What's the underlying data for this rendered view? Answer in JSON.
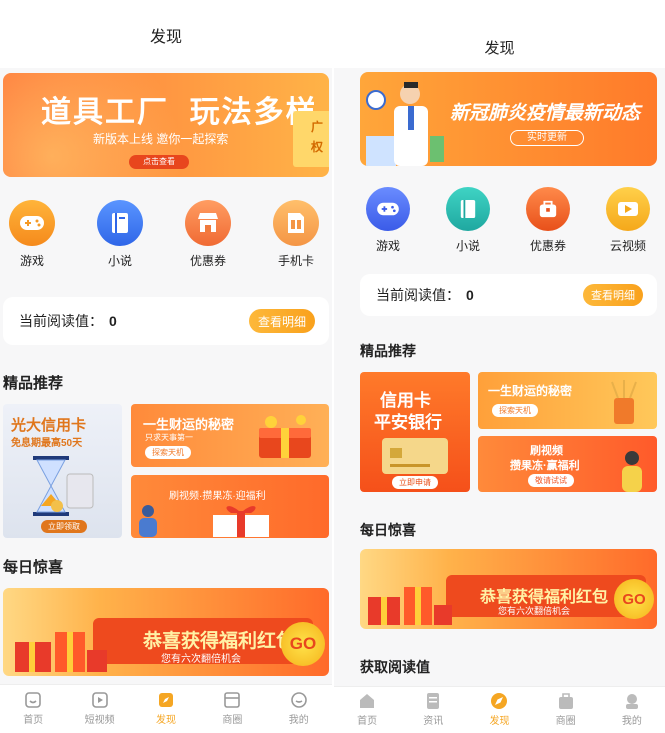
{
  "left": {
    "title": "发现",
    "banner": {
      "headline": "道具工厂  玩法多样",
      "sub": "新版本上线 邀你一起探索",
      "cta": "点击查看",
      "side": "广\n权"
    },
    "icons": [
      {
        "label": "游戏",
        "icon": "gamepad-icon",
        "color": "#f5a623"
      },
      {
        "label": "小说",
        "icon": "book-icon",
        "color": "#3b7ff5"
      },
      {
        "label": "优惠券",
        "icon": "shop-icon",
        "color": "#f07c3a"
      },
      {
        "label": "手机卡",
        "icon": "sim-card-icon",
        "color": "#f3a34a"
      }
    ],
    "reading": {
      "label": "当前阅读值：",
      "value": "0",
      "detail": "查看明细"
    },
    "featured_title": "精品推荐",
    "tiles": {
      "card": {
        "title": "光大信用卡",
        "sub": "免息期最高50天",
        "btn": "立即领取"
      },
      "wealth": {
        "title": "一生财运的秘密",
        "sub": "只求天事第一",
        "btn": "探索天机"
      },
      "video": {
        "title": "刷视频·攒果冻·迎福利"
      }
    },
    "daily_title": "每日惊喜",
    "surprise": {
      "title": "恭喜获得福利红包",
      "sub": "您有六次翻倍机会",
      "go": "GO"
    },
    "tabs": [
      {
        "label": "首页",
        "icon": "home-icon"
      },
      {
        "label": "短视频",
        "icon": "video-icon"
      },
      {
        "label": "发现",
        "icon": "discover-icon",
        "active": true
      },
      {
        "label": "商圈",
        "icon": "store-icon"
      },
      {
        "label": "我的",
        "icon": "profile-icon"
      }
    ]
  },
  "right": {
    "title": "发现",
    "banner": {
      "headline": "新冠肺炎疫情最新动态",
      "cta": "实时更新"
    },
    "icons": [
      {
        "label": "游戏",
        "icon": "gamepad-icon",
        "color": "#4b6cf0"
      },
      {
        "label": "小说",
        "icon": "book-icon",
        "color": "#2bbfb0"
      },
      {
        "label": "优惠券",
        "icon": "shop-icon",
        "color": "#f06a2a"
      },
      {
        "label": "云视频",
        "icon": "play-icon",
        "color": "#f5b82a"
      }
    ],
    "reading": {
      "label": "当前阅读值：",
      "value": "0",
      "detail": "查看明细"
    },
    "featured_title": "精品推荐",
    "tiles": {
      "card": {
        "title": "信用卡",
        "title2": "平安银行",
        "btn": "立即申请"
      },
      "wealth": {
        "title": "一生财运的秘密",
        "btn": "探索天机"
      },
      "video": {
        "title": "刷视频",
        "title2": "攒果冻·赢福利",
        "btn": "敬请试试"
      }
    },
    "daily_title": "每日惊喜",
    "surprise": {
      "title": "恭喜获得福利红包",
      "sub": "您有六次翻倍机会",
      "go": "GO"
    },
    "earn_title": "获取阅读值",
    "tabs": [
      {
        "label": "首页",
        "icon": "home-icon"
      },
      {
        "label": "资讯",
        "icon": "news-icon"
      },
      {
        "label": "发现",
        "icon": "discover-icon",
        "active": true
      },
      {
        "label": "商圈",
        "icon": "store-icon"
      },
      {
        "label": "我的",
        "icon": "profile-icon"
      }
    ]
  }
}
